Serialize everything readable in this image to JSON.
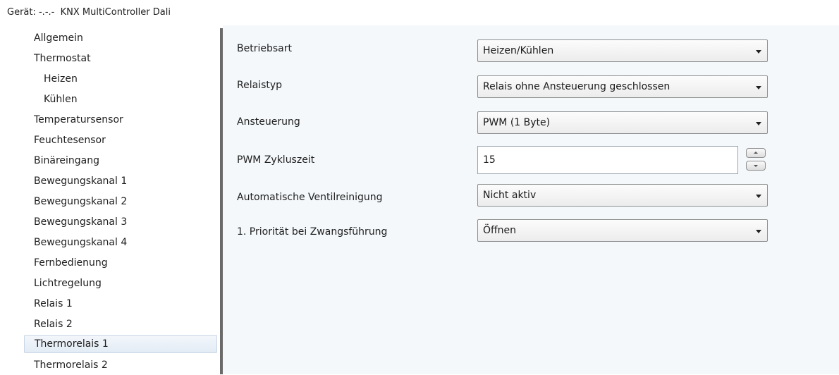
{
  "window": {
    "title": "Gerät: -.-.-  KNX MultiController Dali"
  },
  "sidebar": {
    "items": [
      {
        "label": "Allgemein",
        "level": 0
      },
      {
        "label": "Thermostat",
        "level": 0
      },
      {
        "label": "Heizen",
        "level": 1
      },
      {
        "label": "Kühlen",
        "level": 1
      },
      {
        "label": "Temperatursensor",
        "level": 0
      },
      {
        "label": "Feuchtesensor",
        "level": 0
      },
      {
        "label": "Binäreingang",
        "level": 0
      },
      {
        "label": "Bewegungskanal 1",
        "level": 0
      },
      {
        "label": "Bewegungskanal 2",
        "level": 0
      },
      {
        "label": "Bewegungskanal 3",
        "level": 0
      },
      {
        "label": "Bewegungskanal 4",
        "level": 0
      },
      {
        "label": "Fernbedienung",
        "level": 0
      },
      {
        "label": "Lichtregelung",
        "level": 0
      },
      {
        "label": "Relais 1",
        "level": 0
      },
      {
        "label": "Relais 2",
        "level": 0
      },
      {
        "label": "Thermorelais 1",
        "level": 0,
        "selected": true
      },
      {
        "label": "Thermorelais 2",
        "level": 0
      }
    ]
  },
  "params": {
    "betriebsart": {
      "label": "Betriebsart",
      "value": "Heizen/Kühlen"
    },
    "relaistyp": {
      "label": "Relaistyp",
      "value": "Relais ohne Ansteuerung geschlossen"
    },
    "ansteuerung": {
      "label": "Ansteuerung",
      "value": "PWM (1 Byte)"
    },
    "pwm_zykluszeit": {
      "label": "PWM Zykluszeit",
      "value": "15"
    },
    "ventilreinigung": {
      "label": "Automatische Ventilreinigung",
      "value": "Nicht aktiv"
    },
    "prioritaet": {
      "label": "1. Priorität bei Zwangsführung",
      "value": "Öffnen"
    }
  },
  "colors": {
    "panel_background": "#f4f8fb",
    "divider": "#6a6a6a",
    "selected_item": "#e2ebf5"
  }
}
